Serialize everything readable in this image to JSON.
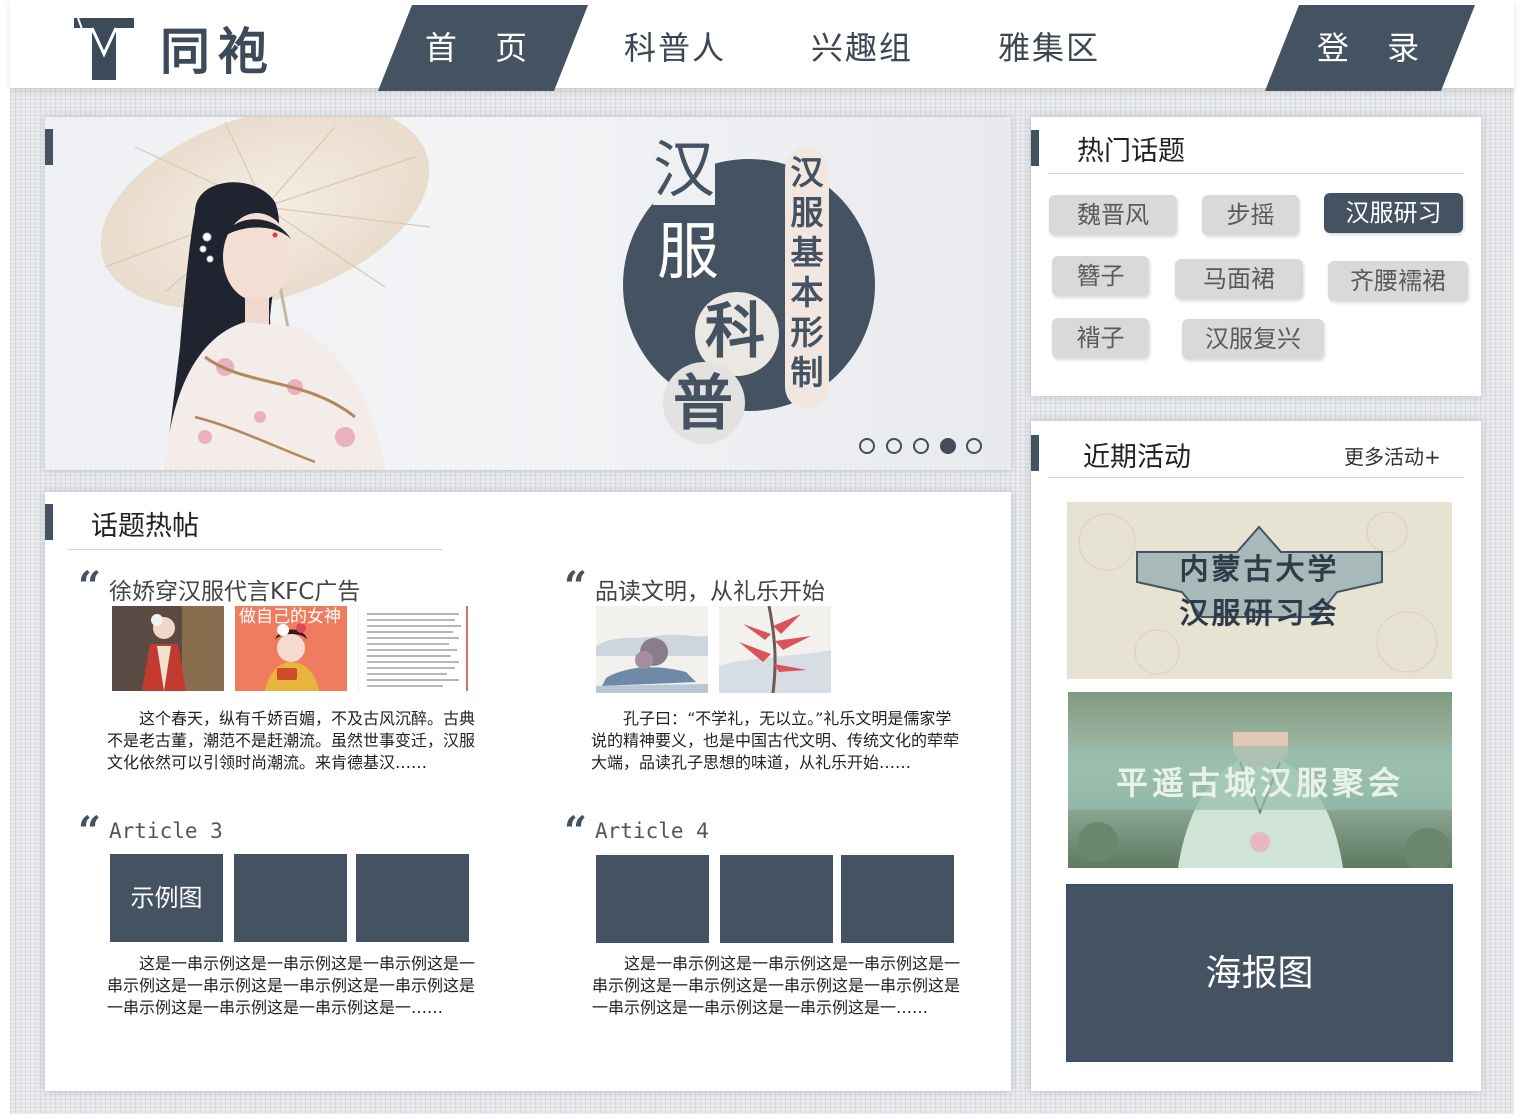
{
  "brand": {
    "name": "同袍"
  },
  "nav": {
    "home": "首 页",
    "science": "科普人",
    "interest": "兴趣组",
    "gallery": "雅集区",
    "login": "登 录"
  },
  "banner": {
    "big_title_1": "汉",
    "big_title_2": "服",
    "big_title_3": "科",
    "big_title_4": "普",
    "vertical_text": "汉服基本形制",
    "prev_arrow": "、",
    "dots_total": 5,
    "active_dot": 4
  },
  "hot_topics": {
    "title": "热门话题",
    "tags": [
      "魏晋风",
      "步摇",
      "汉服研习",
      "簪子",
      "马面裙",
      "齐腰襦裙",
      "褙子",
      "汉服复兴"
    ],
    "active_tag": "汉服研习"
  },
  "recent_activities": {
    "title": "近期活动",
    "more": "更多活动+",
    "items": [
      {
        "line1": "内蒙古大学",
        "line2": "汉服研习会"
      },
      {
        "line1": "平遥古城汉服聚会"
      }
    ],
    "poster": "海报图"
  },
  "hot_posts": {
    "title": "话题热帖",
    "posts": [
      {
        "title": "徐娇穿汉服代言KFC广告",
        "thumb_caption": "做自己的女神",
        "text": "这个春天，纵有千娇百媚，不及古风沉醉。古典不是老古董，潮范不是赶潮流。虽然世事变迁，汉服文化依然可以引领时尚潮流。来肯德基汉……"
      },
      {
        "title": "品读文明，从礼乐开始",
        "text": "孔子曰：“不学礼，无以立。”礼乐文明是儒家学说的精神要义，也是中国古代文明、传统文化的荦荦大端，品读孔子思想的味道，从礼乐开始……"
      },
      {
        "title": "Article 3",
        "thumb_caption": "示例图",
        "text": "这是一串示例这是一串示例这是一串示例这是一串示例这是一串示例这是一串示例这是一串示例这是一串示例这是一串示例这是一串示例这是一……"
      },
      {
        "title": "Article 4",
        "text": "这是一串示例这是一串示例这是一串示例这是一串示例这是一串示例这是一串示例这是一串示例这是一串示例这是一串示例这是一串示例这是一……"
      }
    ]
  },
  "colors": {
    "accent": "#455262",
    "tag_bg": "#d9d9d9",
    "banner_bg": "#eef0f3"
  }
}
